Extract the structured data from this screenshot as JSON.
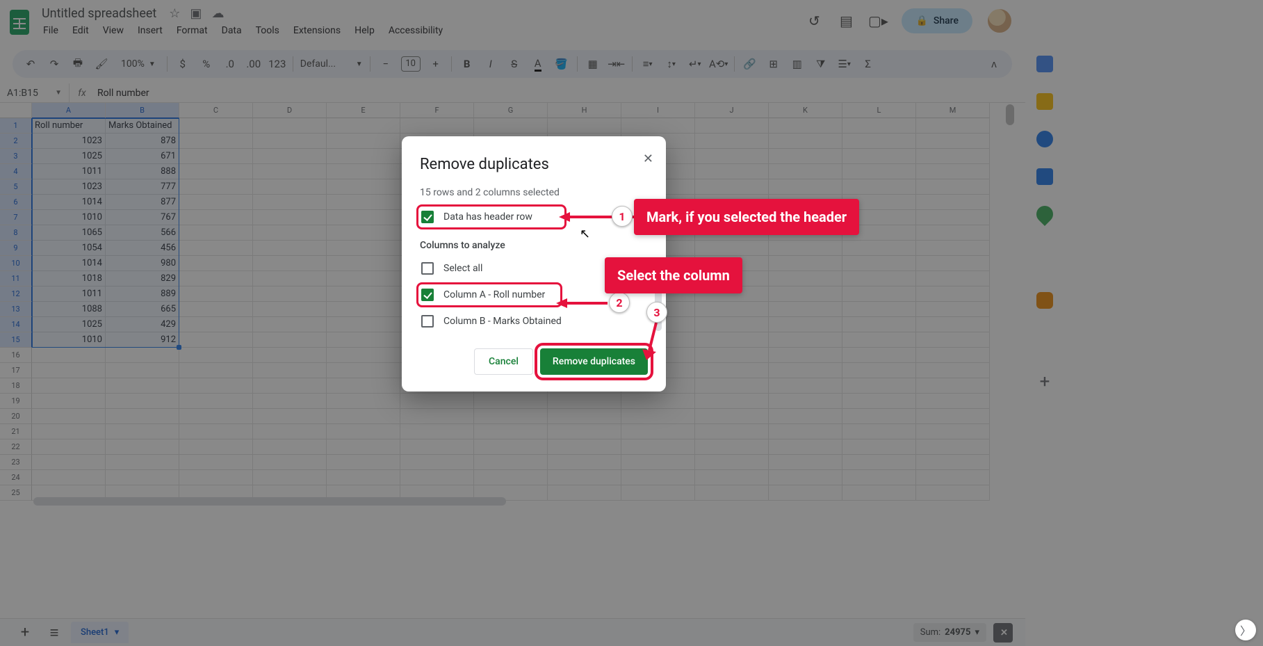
{
  "doc": {
    "title": "Untitled spreadsheet",
    "menus": [
      "File",
      "Edit",
      "View",
      "Insert",
      "Format",
      "Data",
      "Tools",
      "Extensions",
      "Help",
      "Accessibility"
    ],
    "share_label": "Share"
  },
  "toolbar": {
    "zoom": "100%",
    "font": "Defaul...",
    "font_size": "10"
  },
  "name_box": "A1:B15",
  "formula": "Roll number",
  "columns": [
    "A",
    "B",
    "C",
    "D",
    "E",
    "F",
    "G",
    "H",
    "I",
    "J",
    "K",
    "L",
    "M"
  ],
  "selected_col_count": 2,
  "rows_visible": 25,
  "selected_rows": 15,
  "table": {
    "headers": [
      "Roll number",
      "Marks Obtained"
    ],
    "data": [
      [
        1023,
        878
      ],
      [
        1025,
        671
      ],
      [
        1011,
        888
      ],
      [
        1023,
        777
      ],
      [
        1014,
        877
      ],
      [
        1010,
        767
      ],
      [
        1065,
        566
      ],
      [
        1054,
        456
      ],
      [
        1014,
        980
      ],
      [
        1018,
        829
      ],
      [
        1011,
        889
      ],
      [
        1088,
        665
      ],
      [
        1025,
        429
      ],
      [
        1010,
        912
      ]
    ]
  },
  "dialog": {
    "title": "Remove duplicates",
    "info_text": "15 rows and 2 columns selected",
    "header_checkbox_label": "Data has header row",
    "header_checkbox_checked": true,
    "columns_title": "Columns to analyze",
    "options": [
      {
        "label": "Select all",
        "checked": false
      },
      {
        "label": "Column A - Roll number",
        "checked": true
      },
      {
        "label": "Column B - Marks Obtained",
        "checked": false
      }
    ],
    "cancel": "Cancel",
    "confirm": "Remove duplicates"
  },
  "annotations": {
    "a1": "Mark, if you selected the header",
    "a2": "Select the column",
    "n1": "1",
    "n2": "2",
    "n3": "3"
  },
  "sheet_tabs": {
    "active": "Sheet1"
  },
  "status": {
    "sum_label": "Sum:",
    "sum_value": "24975"
  }
}
